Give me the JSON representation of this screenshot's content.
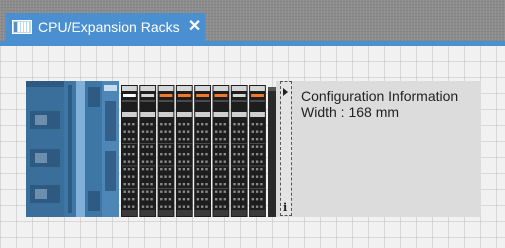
{
  "tab": {
    "title": "CPU/Expansion Racks",
    "close_glyph": "✕",
    "icon": "rack-icon",
    "active_color": "#4a8fd0"
  },
  "config_info": {
    "title": "Configuration Information",
    "width_text": "Width : 168 mm",
    "info_glyph": "i"
  },
  "rack": {
    "io_unit_count": 8,
    "indicator_color": "#f07a2a"
  }
}
